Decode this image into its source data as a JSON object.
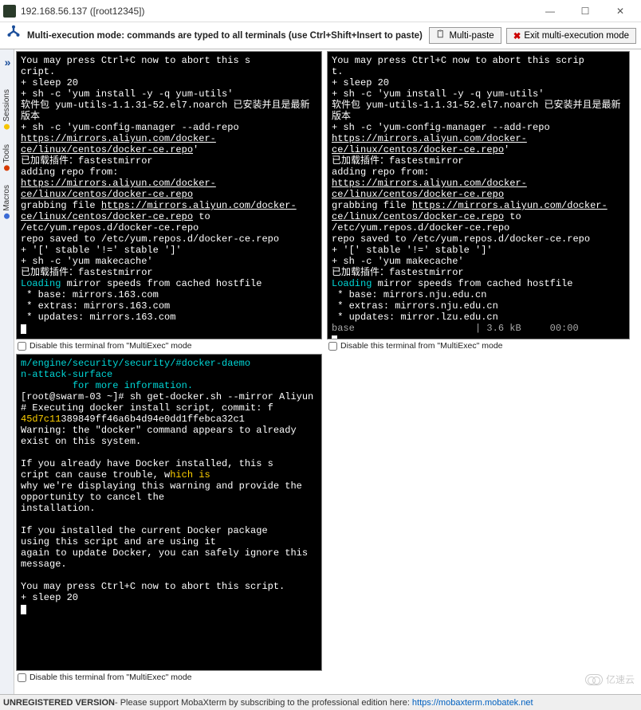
{
  "window": {
    "title": "192.168.56.137 ([root12345])"
  },
  "winctl": {
    "min": "—",
    "max": "☐",
    "close": "✕"
  },
  "toolbar": {
    "message": "Multi-execution mode: commands are typed to all terminals (use Ctrl+Shift+Insert to paste)",
    "multipaste": "Multi-paste",
    "exit": "Exit multi-execution mode"
  },
  "sidetabs": {
    "sessions": "Sessions",
    "tools": "Tools",
    "macros": "Macros"
  },
  "disable_label": "Disable this terminal from \"MultiExec\" mode",
  "term1": {
    "l1": "You may press Ctrl+C now to abort this s",
    "l2": "cript.",
    "l3": "+ sleep 20",
    "l4": "+ sh -c 'yum install -y -q yum-utils'",
    "l5": "软件包 yum-utils-1.1.31-52.el7.noarch 已安装并且是最新版本",
    "l6a": "+ sh -c 'yum-config-manager --add-repo ",
    "l6b": "https://mirrors.aliyun.com/docker-ce/linux/centos/docker-ce.repo",
    "l6c": "'",
    "l7": "已加载插件：fastestmirror",
    "l8a": "adding repo from: ",
    "l8b": "https://mirrors.aliyun.com/docker-ce/linux/centos/docker-ce.repo",
    "l9a": "grabbing file ",
    "l9b": "https://mirrors.aliyun.com/docker-ce/linux/centos/docker-ce.repo",
    "l9c": " to /etc/yum.repos.d/docker-ce.repo",
    "l10": "repo saved to /etc/yum.repos.d/docker-ce.repo",
    "l11": "+ '[' stable '!=' stable ']'",
    "l12": "+ sh -c 'yum makecache'",
    "l13": "已加载插件：fastestmirror",
    "l14a": "Loading",
    "l14b": " mirror speeds from cached hostfile",
    "l15": " * base: mirrors.163.com",
    "l16": " * extras: mirrors.163.com",
    "l17": " * updates: mirrors.163.com"
  },
  "term2": {
    "l1": "You may press Ctrl+C now to abort this scrip",
    "l2": "t.",
    "l3": "+ sleep 20",
    "l4": "+ sh -c 'yum install -y -q yum-utils'",
    "l5": "软件包 yum-utils-1.1.31-52.el7.noarch 已安装并且是最新版本",
    "l6a": "+ sh -c 'yum-config-manager --add-repo ",
    "l6b": "https://mirrors.aliyun.com/docker-ce/linux/centos/docker-ce.repo",
    "l6c": "'",
    "l7": "已加载插件：fastestmirror",
    "l8a": "adding repo from: ",
    "l8b": "https://mirrors.aliyun.com/docker-ce/linux/centos/docker-ce.repo",
    "l9a": "grabbing file ",
    "l9b": "https://mirrors.aliyun.com/docker-ce/linux/centos/docker-ce.repo",
    "l9c": " to /etc/yum.repos.d/docker-ce.repo",
    "l10": "repo saved to /etc/yum.repos.d/docker-ce.repo",
    "l11": "+ '[' stable '!=' stable ']'",
    "l12": "+ sh -c 'yum makecache'",
    "l13": "已加载插件：fastestmirror",
    "l14a": "Loading",
    "l14b": " mirror speeds from cached hostfile",
    "l15": " * base: mirrors.nju.edu.cn",
    "l16": " * extras: mirrors.nju.edu.cn",
    "l17": " * updates: mirror.lzu.edu.cn",
    "l18": "base                     | 3.6 kB     00:00"
  },
  "term3": {
    "l1": "m/engine/security/security/#docker-daemo",
    "l2": "n-attack-surface",
    "l3": "         for more information.",
    "l4": "[root@swarm-03 ~]# sh get-docker.sh --mirror Aliyun",
    "l5": "# Executing docker install script, commit: f",
    "l6a": "45d7c11",
    "l6b": "389849ff46a6b4d94e0dd1ffebca32c1",
    "l7": "Warning: the \"docker\" command appears to already exist on this system.",
    "l8": "",
    "l9": "If you already have Docker installed, this s",
    "l10a": "cript can cause trouble, w",
    "l10b": "hich is",
    "l11": "why we're displaying this warning and provide the opportunity to cancel the",
    "l12": "installation.",
    "l13": "",
    "l14": "If you installed the current Docker package",
    "l15": "using this script and are using it",
    "l16": "again to update Docker, you can safely ignore this message.",
    "l17": "",
    "l18": "You may press Ctrl+C now to abort this script.",
    "l19": "+ sleep 20"
  },
  "status": {
    "bold": "UNREGISTERED VERSION",
    "text": " -  Please support MobaXterm by subscribing to the professional edition here: ",
    "url": "https://mobaxterm.mobatek.net"
  },
  "watermark": "亿速云"
}
